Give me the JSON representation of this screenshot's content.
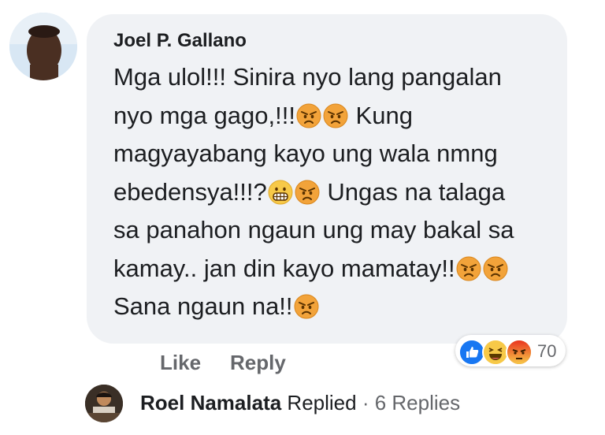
{
  "comment": {
    "author": "Joel P. Gallano",
    "lines": [
      [
        "Mga ulol!!! Sinira nyo lang pangalan"
      ],
      [
        "nyo mga gago,!!!",
        "angry",
        "angry",
        " Kung"
      ],
      [
        "magyayabang kayo ung wala nmng"
      ],
      [
        "ebedensya!!!?",
        "grimace",
        "angry",
        " Ungas na talaga"
      ],
      [
        "sa panahon ngaun ung may bakal sa"
      ],
      [
        "kamay.. jan din kayo mamatay!!",
        "angry",
        "angry"
      ],
      [
        "Sana ngaun na!!",
        "angry"
      ]
    ]
  },
  "actions": {
    "like_label": "Like",
    "reply_label": "Reply"
  },
  "reactions": {
    "icons": [
      "like-icon",
      "haha-icon",
      "angry-icon"
    ],
    "count": "70",
    "colors": {
      "like": "#1877f2",
      "haha": "#f7c948",
      "angry": "#e9710f"
    }
  },
  "replies": {
    "name": "Roel Namalata",
    "action": " Replied",
    "separator": " · ",
    "count_label": "6 Replies"
  }
}
